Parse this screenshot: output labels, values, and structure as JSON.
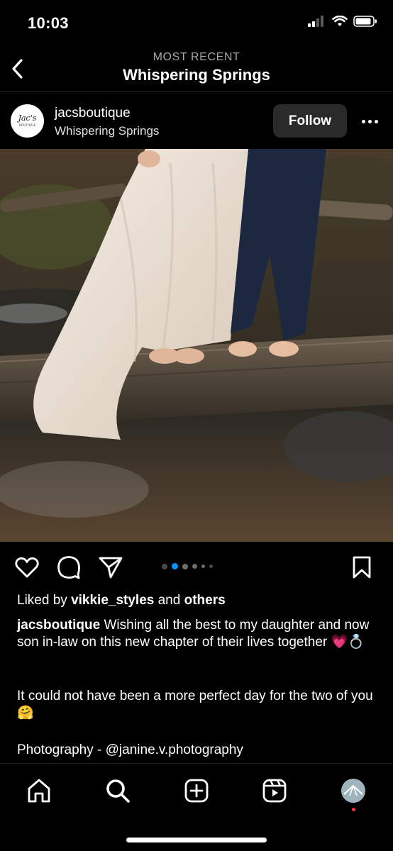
{
  "status_bar": {
    "time": "10:03"
  },
  "header": {
    "subtitle": "MOST RECENT",
    "title": "Whispering Springs"
  },
  "post": {
    "avatar_text": "Jac's",
    "avatar_subtext": "BOUTIQUE",
    "username": "jacsboutique",
    "location": "Whispering Springs",
    "follow_label": "Follow",
    "carousel_count": 6,
    "carousel_active_index": 1
  },
  "likes": {
    "prefix": "Liked by",
    "user": "vikkie_styles",
    "conjunction": "and",
    "others": "others"
  },
  "caption": {
    "username": "jacsboutique",
    "text": "Wishing all the best to my daughter and now son in-law on this new chapter of their lives together 💗💍",
    "paragraph2": "It could not have been a more perfect day for the two of you 🤗",
    "paragraph3": "Photography - @janine.v.photography"
  },
  "colors": {
    "background": "#000000",
    "accent": "#0095f6",
    "button_bg": "#2a2a2a",
    "notification": "#ff3040"
  },
  "icons": {
    "back": "chevron-left-icon",
    "like": "heart-icon",
    "comment": "comment-icon",
    "share": "paper-plane-icon",
    "save": "bookmark-icon",
    "home": "home-icon",
    "search": "search-icon",
    "create": "plus-square-icon",
    "reels": "reels-icon",
    "profile": "profile-avatar"
  }
}
